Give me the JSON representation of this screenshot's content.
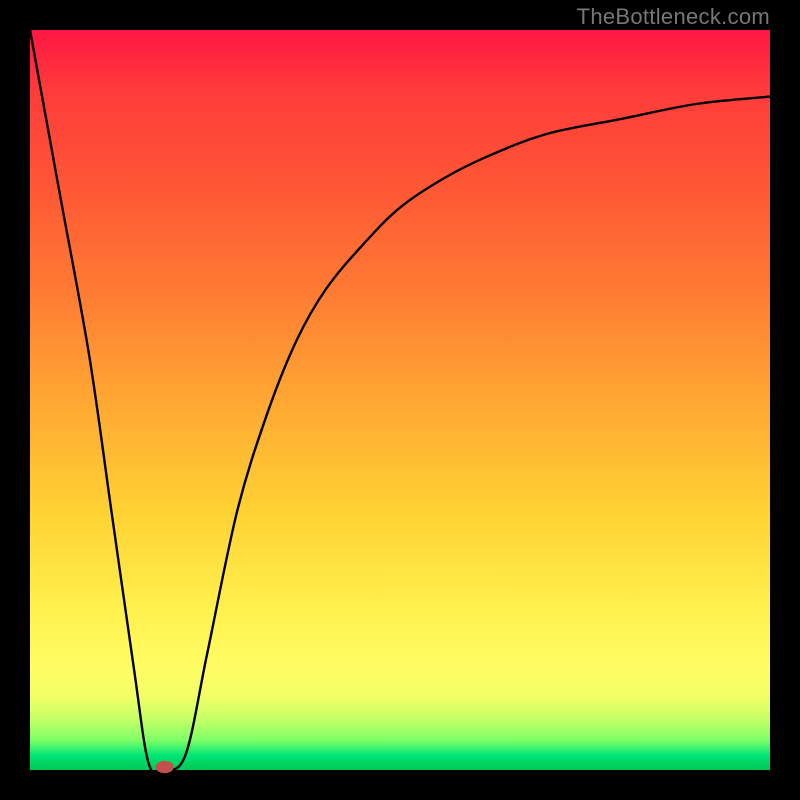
{
  "watermark": "TheBottleneck.com",
  "chart_data": {
    "type": "line",
    "title": "",
    "xlabel": "",
    "ylabel": "",
    "xlim": [
      0,
      100
    ],
    "ylim": [
      0,
      100
    ],
    "grid": false,
    "legend": false,
    "series": [
      {
        "name": "curve",
        "x": [
          0,
          4,
          8,
          11,
          14,
          16,
          18,
          21,
          24,
          28,
          32,
          36,
          40,
          45,
          50,
          56,
          62,
          70,
          80,
          90,
          100
        ],
        "values": [
          100,
          78,
          56,
          35,
          14,
          1,
          0,
          2,
          16,
          35,
          48,
          58,
          65,
          71,
          76,
          80,
          83,
          86,
          88,
          90,
          91
        ]
      }
    ],
    "marker": {
      "x": 18.2,
      "y": 0,
      "color": "#c0504d",
      "rx": 9,
      "ry": 6
    }
  }
}
